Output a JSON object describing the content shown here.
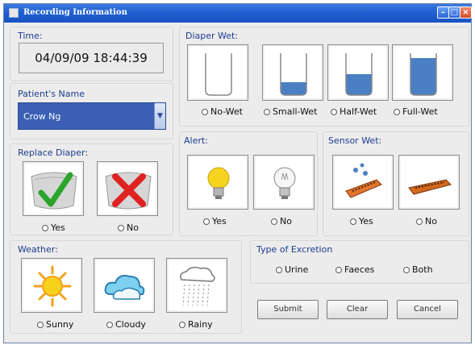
{
  "window": {
    "title": "Recording Information",
    "controls": [
      "minimize",
      "maximize",
      "close"
    ]
  },
  "time": {
    "label": "Time:",
    "value": "04/09/09 18:44:39"
  },
  "patient": {
    "label": "Patient's Name",
    "selected": "Crow Ng"
  },
  "replace_diaper": {
    "label": "Replace Diaper:",
    "options": [
      "Yes",
      "No"
    ]
  },
  "diaper_wet": {
    "label": "Diaper Wet:",
    "options": [
      "No-Wet",
      "Small-Wet",
      "Half-Wet",
      "Full-Wet"
    ],
    "fill_levels": [
      0,
      0.25,
      0.45,
      0.85
    ]
  },
  "alert": {
    "label": "Alert:",
    "options": [
      "Yes",
      "No"
    ]
  },
  "sensor_wet": {
    "label": "Sensor Wet:",
    "options": [
      "Yes",
      "No"
    ]
  },
  "weather": {
    "label": "Weather:",
    "options": [
      "Sunny",
      "Cloudy",
      "Rainy"
    ]
  },
  "excretion": {
    "label": "Type of Excretion",
    "options": [
      "Urine",
      "Faeces",
      "Both"
    ]
  },
  "buttons": {
    "submit": "Submit",
    "clear": "Clear",
    "cancel": "Cancel"
  },
  "colors": {
    "title_bar": "#1f5fd0",
    "group_label": "#1d3c8f",
    "water": "#4a7fc4",
    "check": "#2aa52a",
    "cross": "#e02222"
  }
}
